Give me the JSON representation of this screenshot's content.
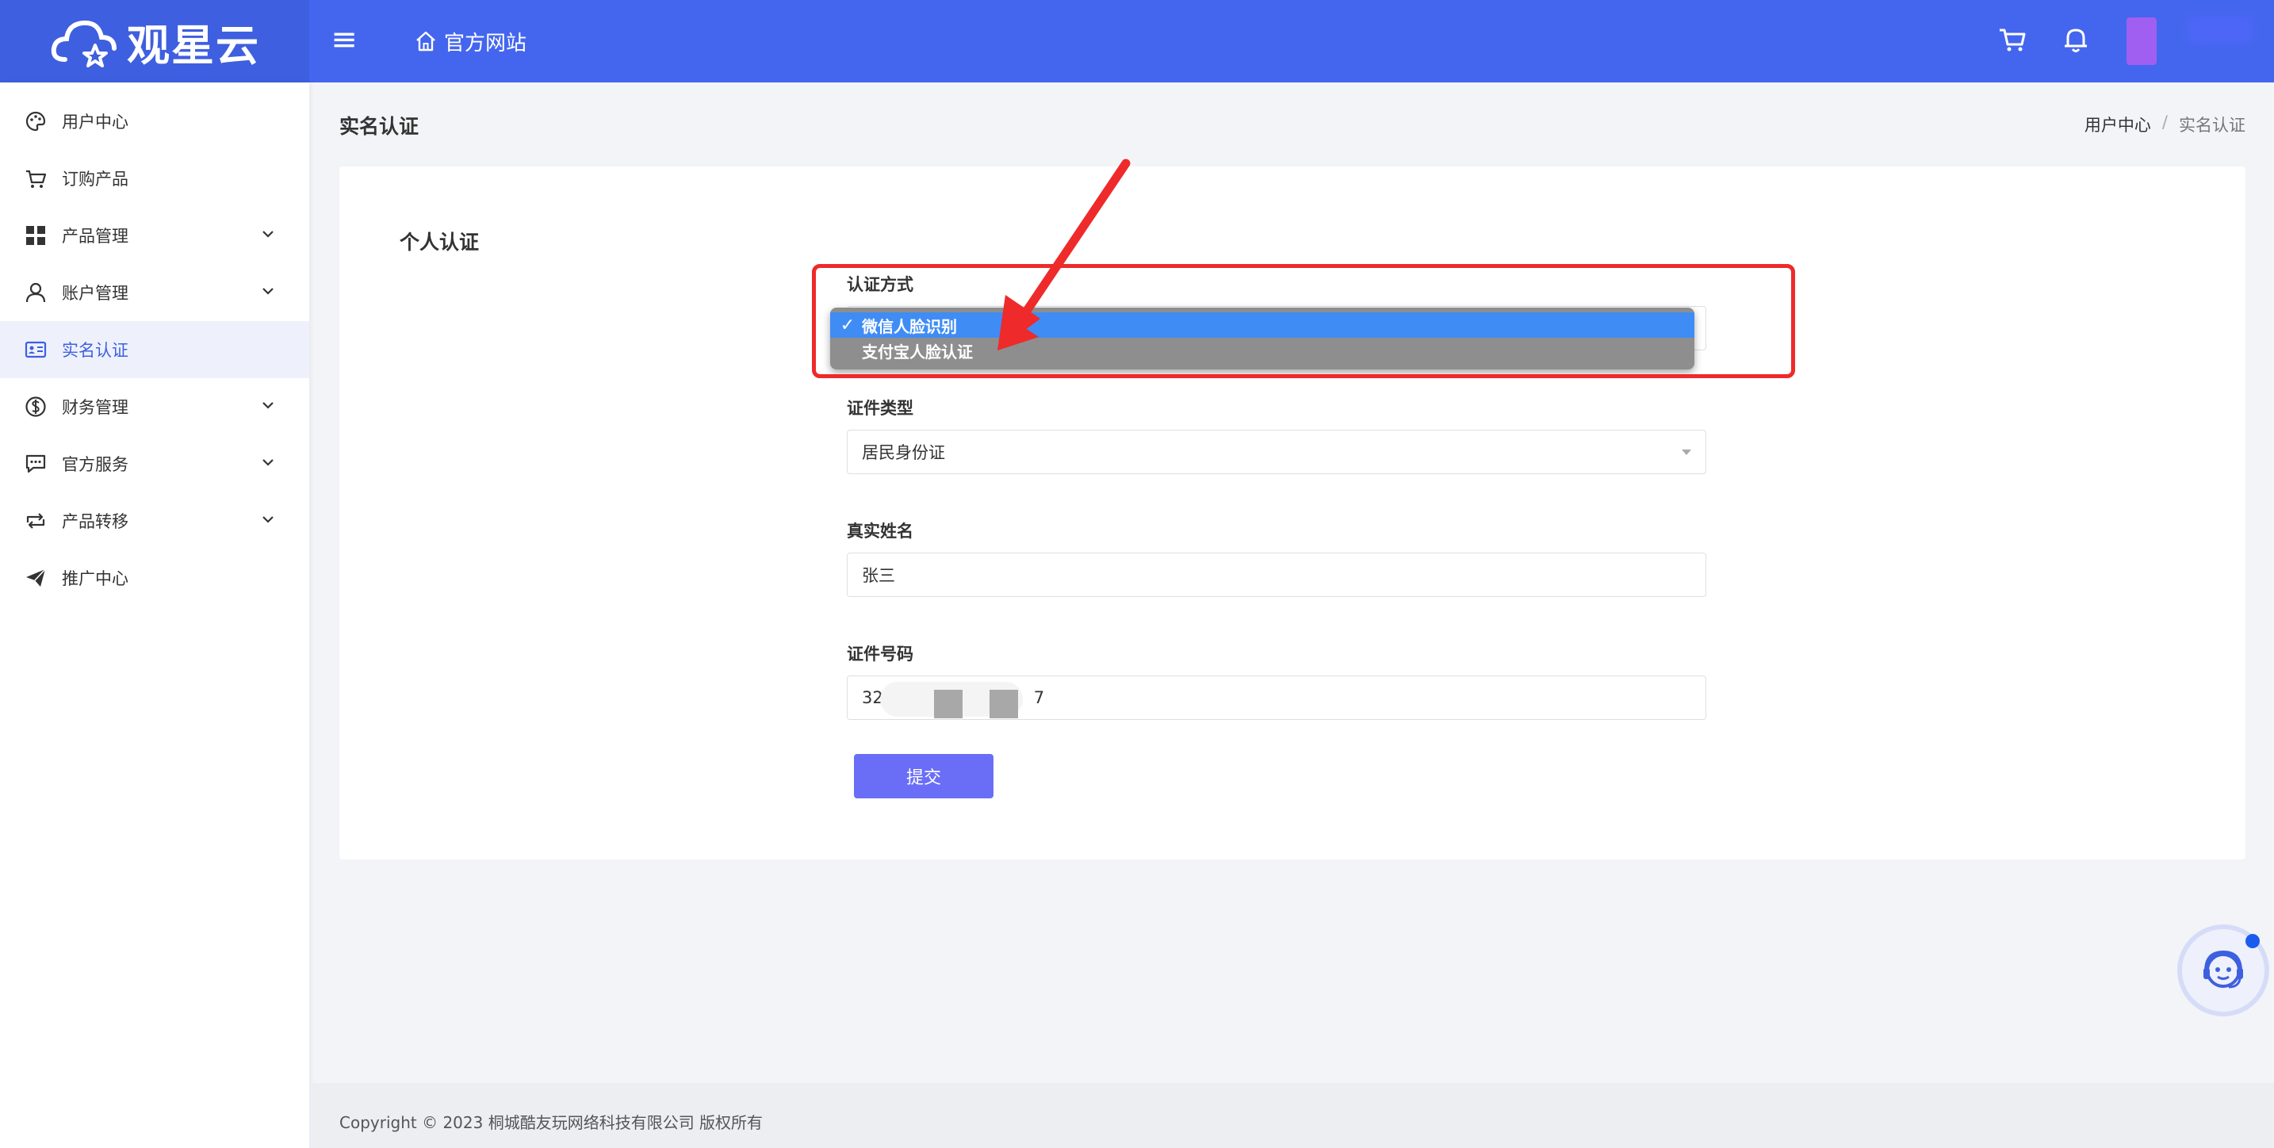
{
  "brand": {
    "name": "观星云"
  },
  "header": {
    "site_link_label": "官方网站",
    "accent_color": "#4466ee"
  },
  "sidebar": {
    "items": [
      {
        "label": "用户中心",
        "icon": "palette-icon",
        "has_children": false
      },
      {
        "label": "订购产品",
        "icon": "cart-icon",
        "has_children": false
      },
      {
        "label": "产品管理",
        "icon": "grid-icon",
        "has_children": true
      },
      {
        "label": "账户管理",
        "icon": "user-icon",
        "has_children": true
      },
      {
        "label": "实名认证",
        "icon": "id-card-icon",
        "has_children": false,
        "active": true
      },
      {
        "label": "财务管理",
        "icon": "dollar-icon",
        "has_children": true
      },
      {
        "label": "官方服务",
        "icon": "chat-icon",
        "has_children": true
      },
      {
        "label": "产品转移",
        "icon": "transfer-icon",
        "has_children": true
      },
      {
        "label": "推广中心",
        "icon": "send-icon",
        "has_children": false
      }
    ]
  },
  "page": {
    "title": "实名认证",
    "breadcrumb": [
      "用户中心",
      "/",
      "实名认证"
    ]
  },
  "form": {
    "section_title": "个人认证",
    "auth_method": {
      "label": "认证方式",
      "options": [
        "微信人脸识别",
        "支付宝人脸认证"
      ],
      "selected": "微信人脸识别",
      "check_mark": "✓"
    },
    "id_type": {
      "label": "证件类型",
      "value": "居民身份证"
    },
    "real_name": {
      "label": "真实姓名",
      "value": "张三"
    },
    "id_number": {
      "label": "证件号码",
      "value_prefix": "32",
      "value_suffix": "7"
    },
    "submit_label": "提交",
    "submit_color": "#6a6ef7"
  },
  "footer": {
    "text": "Copyright © 2023 桐城酷友玩网络科技有限公司 版权所有"
  },
  "annotation": {
    "color": "#ee2a2a"
  }
}
